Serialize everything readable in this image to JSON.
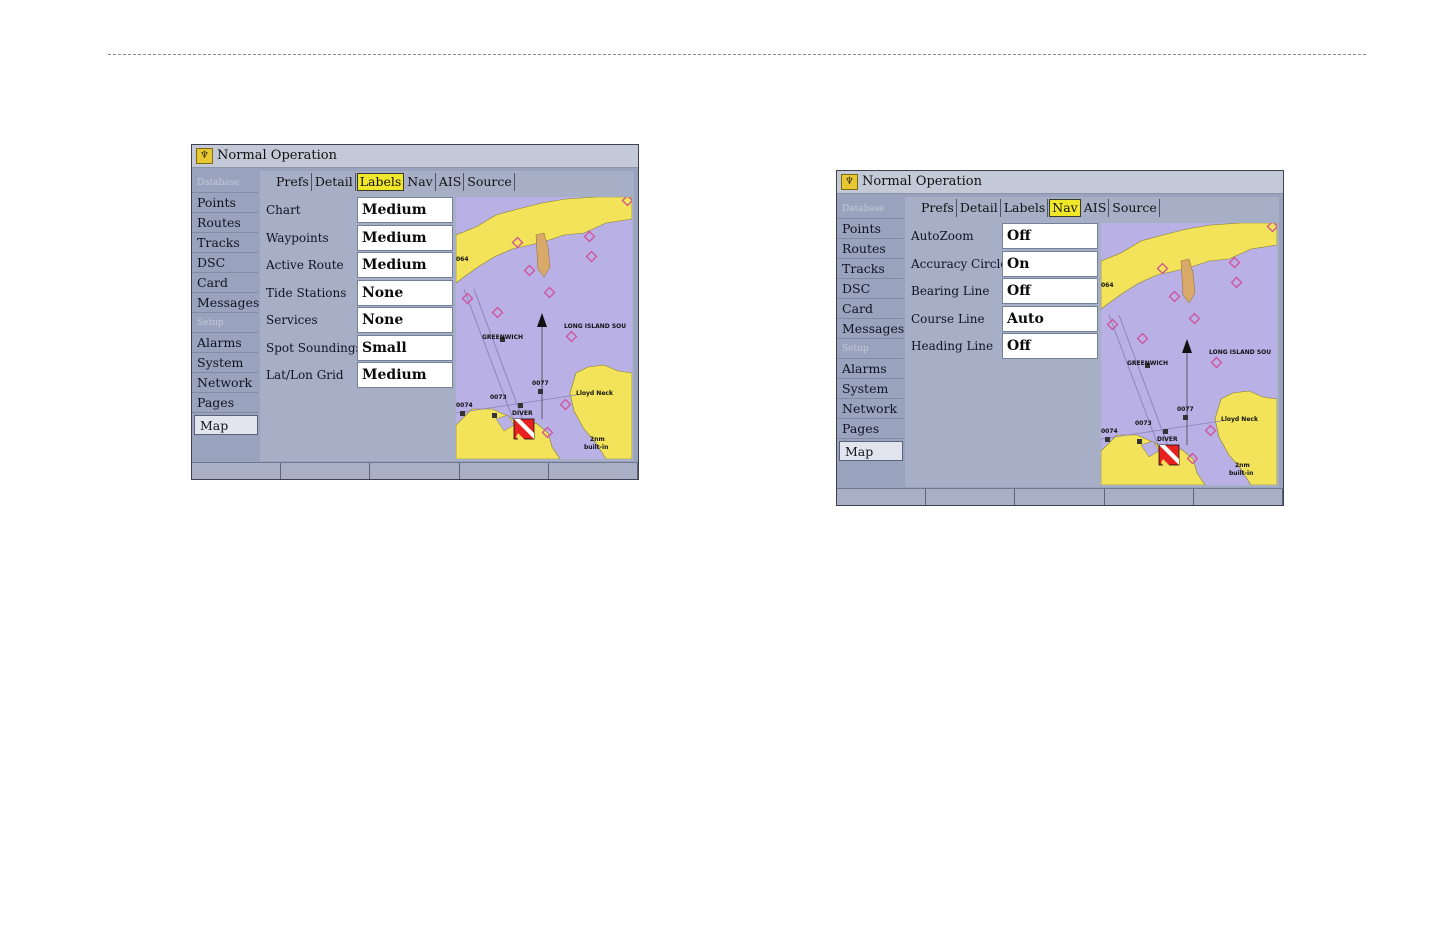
{
  "screens": [
    {
      "window_title": "Normal Operation",
      "sidebar": {
        "header1": "Database",
        "items_a": [
          "Points",
          "Routes",
          "Tracks",
          "DSC",
          "Card",
          "Messages"
        ],
        "header2": "Setup",
        "items_b": [
          "Alarms",
          "System",
          "Network",
          "Pages",
          "Map"
        ],
        "active": "Map"
      },
      "tabs": [
        {
          "label": "Prefs",
          "active": false
        },
        {
          "label": "Detail",
          "active": false
        },
        {
          "label": "Labels",
          "active": true
        },
        {
          "label": "Nav",
          "active": false
        },
        {
          "label": "AIS",
          "active": false
        },
        {
          "label": "Source",
          "active": false
        }
      ],
      "settings": [
        {
          "label": "Chart",
          "value": "Medium"
        },
        {
          "label": "Waypoints",
          "value": "Medium"
        },
        {
          "label": "Active Route",
          "value": "Medium"
        },
        {
          "label": "Tide Stations",
          "value": "None"
        },
        {
          "label": "Services",
          "value": "None"
        },
        {
          "label": "Spot Soundings",
          "value": "Small"
        },
        {
          "label": "Lat/Lon Grid",
          "value": "Medium"
        }
      ],
      "map": {
        "labels": {
          "greenwich": "GREENWICH",
          "sound": "LONG ISLAND SOU",
          "lloyd": "Lloyd Neck",
          "zoom": "2nm",
          "builtin": "built-in",
          "wp77": "0077",
          "wp73": "0073",
          "wp74": "0074",
          "diver": "DIVER",
          "wp64": "064"
        }
      },
      "softkeys": [
        "",
        "",
        "",
        "",
        ""
      ]
    },
    {
      "window_title": "Normal Operation",
      "sidebar": {
        "header1": "Database",
        "items_a": [
          "Points",
          "Routes",
          "Tracks",
          "DSC",
          "Card",
          "Messages"
        ],
        "header2": "Setup",
        "items_b": [
          "Alarms",
          "System",
          "Network",
          "Pages",
          "Map"
        ],
        "active": "Map"
      },
      "tabs": [
        {
          "label": "Prefs",
          "active": false
        },
        {
          "label": "Detail",
          "active": false
        },
        {
          "label": "Labels",
          "active": false
        },
        {
          "label": "Nav",
          "active": true
        },
        {
          "label": "AIS",
          "active": false
        },
        {
          "label": "Source",
          "active": false
        }
      ],
      "settings": [
        {
          "label": "AutoZoom",
          "value": "Off"
        },
        {
          "label": "Accuracy Circle",
          "value": "On"
        },
        {
          "label": "Bearing Line",
          "value": "Off"
        },
        {
          "label": "Course Line",
          "value": "Auto"
        },
        {
          "label": "Heading Line",
          "value": "Off"
        }
      ],
      "map": {
        "labels": {
          "greenwich": "GREENWICH",
          "sound": "LONG ISLAND SOU",
          "lloyd": "Lloyd Neck",
          "zoom": "2nm",
          "builtin": "built-in",
          "wp77": "0077",
          "wp73": "0073",
          "wp74": "0074",
          "diver": "DIVER",
          "wp64": "064"
        }
      },
      "softkeys": [
        "",
        "",
        "",
        "",
        ""
      ]
    }
  ],
  "colors": {
    "land": "#f2e35a",
    "water": "#b9b0e6",
    "marsh": "#d9a96a",
    "waypoint": "#d0509a",
    "tab_highlight": "#f0e62a"
  }
}
